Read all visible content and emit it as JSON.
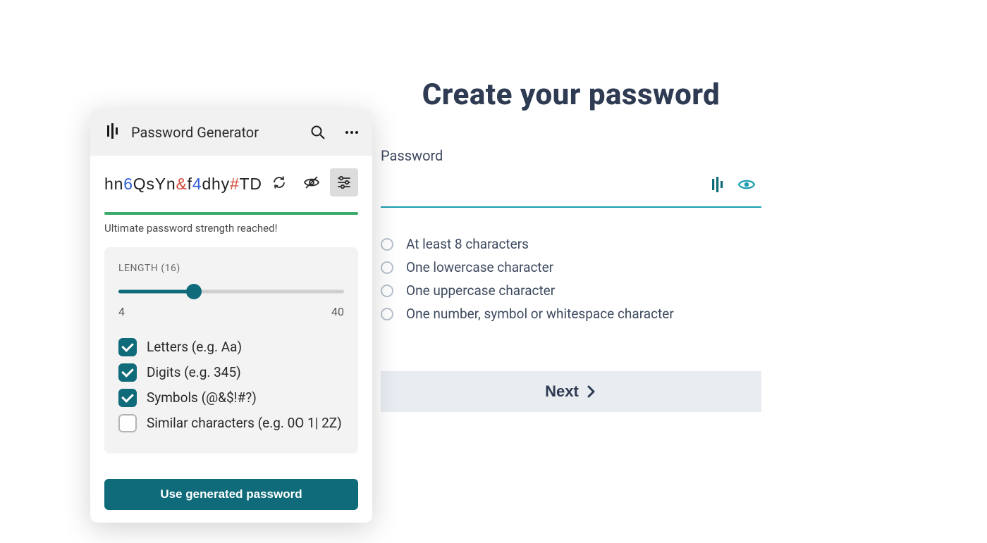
{
  "page": {
    "title": "Create your password",
    "field_label": "Password",
    "input_value": "",
    "requirements": [
      "At least 8 characters",
      "One lowercase character",
      "One uppercase character",
      "One number, symbol or whitespace character"
    ],
    "next_label": "Next"
  },
  "popup": {
    "title": "Password Generator",
    "password_tokens": [
      {
        "t": "hn",
        "c": "plain"
      },
      {
        "t": "6",
        "c": "digit"
      },
      {
        "t": "QsYn",
        "c": "plain"
      },
      {
        "t": "&",
        "c": "symbol"
      },
      {
        "t": "f",
        "c": "plain"
      },
      {
        "t": "4",
        "c": "digit"
      },
      {
        "t": "dhy",
        "c": "plain"
      },
      {
        "t": "#",
        "c": "symbol"
      },
      {
        "t": "TD",
        "c": "plain"
      }
    ],
    "strength_text": "Ultimate password strength reached!",
    "length_label_prefix": "LENGTH",
    "length_value": 16,
    "length_min": 4,
    "length_max": 40,
    "options": [
      {
        "label": "Letters (e.g. Aa)",
        "checked": true
      },
      {
        "label": "Digits (e.g. 345)",
        "checked": true
      },
      {
        "label": "Symbols (@&$!#?)",
        "checked": true
      },
      {
        "label": "Similar characters (e.g. 0O 1| 2Z)",
        "checked": false
      }
    ],
    "use_button_label": "Use generated password",
    "colors": {
      "brand": "#0f6b7a",
      "accent": "#1a9db0",
      "strength": "#3aa96a",
      "digit": "#2f5fd6",
      "symbol": "#d24a3a",
      "heading": "#2e3b52"
    }
  }
}
